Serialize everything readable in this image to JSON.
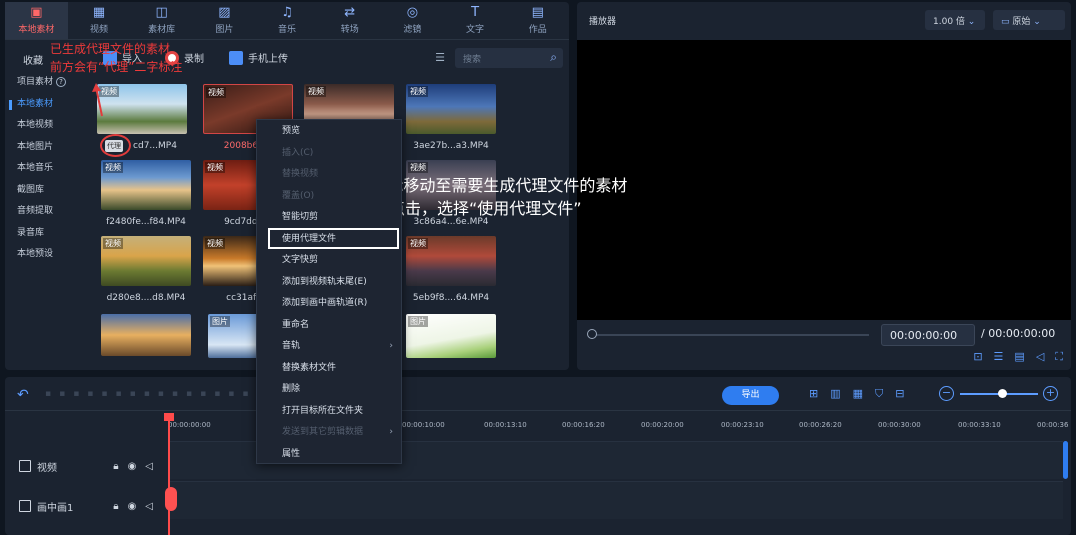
{
  "nav": [
    {
      "label": "本地素材",
      "icon": "local-media-icon",
      "active": true
    },
    {
      "label": "视频",
      "icon": "video-icon"
    },
    {
      "label": "素材库",
      "icon": "library-icon"
    },
    {
      "label": "图片",
      "icon": "image-icon"
    },
    {
      "label": "音乐",
      "icon": "music-icon"
    },
    {
      "label": "转场",
      "icon": "transition-icon"
    },
    {
      "label": "滤镜",
      "icon": "filter-icon"
    },
    {
      "label": "文字",
      "icon": "text-icon"
    },
    {
      "label": "作品",
      "icon": "works-icon"
    }
  ],
  "toolbar": {
    "favorites": "收藏",
    "import": "导入",
    "record": "录制",
    "phone_upload": "手机上传",
    "search_placeholder": "搜索"
  },
  "sidebar": [
    {
      "label": "项目素材"
    },
    {
      "label": "本地素材",
      "active": true
    },
    {
      "label": "本地视频"
    },
    {
      "label": "本地图片"
    },
    {
      "label": "本地音乐"
    },
    {
      "label": "截图库"
    },
    {
      "label": "音频提取"
    },
    {
      "label": "录音库"
    },
    {
      "label": "本地预设"
    }
  ],
  "media": [
    {
      "tag": "视频",
      "name": "cd7...MP4",
      "proxy": "代理"
    },
    {
      "tag": "视频",
      "name": "2008b6...a",
      "highlight": true
    },
    {
      "tag": "视频",
      "name": ""
    },
    {
      "tag": "视频",
      "name": "3ae27b...a3.MP4"
    },
    {
      "tag": "视频",
      "name": "f2480fe...f84.MP4"
    },
    {
      "tag": "视频",
      "name": "9cd7dd...0"
    },
    {
      "tag": "视频",
      "name": ""
    },
    {
      "tag": "视频",
      "name": "3c86a4...6e.MP4"
    },
    {
      "tag": "视频",
      "name": "d280e8....d8.MP4"
    },
    {
      "tag": "视频",
      "name": "cc31af...7"
    },
    {
      "tag": "视频",
      "name": ""
    },
    {
      "tag": "视频",
      "name": "5eb9f8....64.MP4"
    },
    {
      "tag": "",
      "name": ""
    },
    {
      "tag": "图片",
      "name": ""
    },
    {
      "tag": "",
      "name": ""
    },
    {
      "tag": "图片",
      "name": ""
    }
  ],
  "annotations": {
    "red_line1": "已生成代理文件的素材",
    "red_line2": "前方会有“代理”二字标注",
    "white_line1": "①鼠标移动至需要生成代理文件的素材",
    "white_line2": "右键点击，选择“使用代理文件”"
  },
  "context_menu": [
    {
      "label": "预览"
    },
    {
      "label": "插入(C)",
      "disabled": true
    },
    {
      "label": "替换视频",
      "disabled": true
    },
    {
      "label": "覆盖(O)",
      "disabled": true
    },
    {
      "label": "智能切剪"
    },
    {
      "label": "使用代理文件",
      "selected": true
    },
    {
      "label": "文字快剪"
    },
    {
      "label": "添加到视频轨末尾(E)"
    },
    {
      "label": "添加到画中画轨道(R)"
    },
    {
      "label": "重命名"
    },
    {
      "label": "音轨",
      "submenu": true
    },
    {
      "label": "替换素材文件"
    },
    {
      "label": "删除"
    },
    {
      "label": "打开目标所在文件夹"
    },
    {
      "label": "发送到其它剪辑数据",
      "disabled": true,
      "submenu": true
    },
    {
      "label": "属性"
    }
  ],
  "player": {
    "title": "播放器",
    "speed": "1.00 倍",
    "ratio": "原始",
    "current_time": "00:00:00:00",
    "total_time": "/ 00:00:00:00"
  },
  "timeline": {
    "export": "导出",
    "ticks": [
      "00:00:00:00",
      "00:00:10:00",
      "00:00:13:10",
      "00:00:16:20",
      "00:00:20:00",
      "00:00:23:10",
      "00:00:26:20",
      "00:00:30:00",
      "00:00:33:10",
      "00:00:36"
    ],
    "tracks": [
      {
        "label": "视频",
        "icon": "video-track-icon"
      },
      {
        "label": "画中画1",
        "icon": "pip-track-icon"
      }
    ]
  },
  "colors": {
    "accent": "#2f7df0",
    "annotation_red": "#ee3a3a",
    "active_nav": "#ff6868"
  }
}
